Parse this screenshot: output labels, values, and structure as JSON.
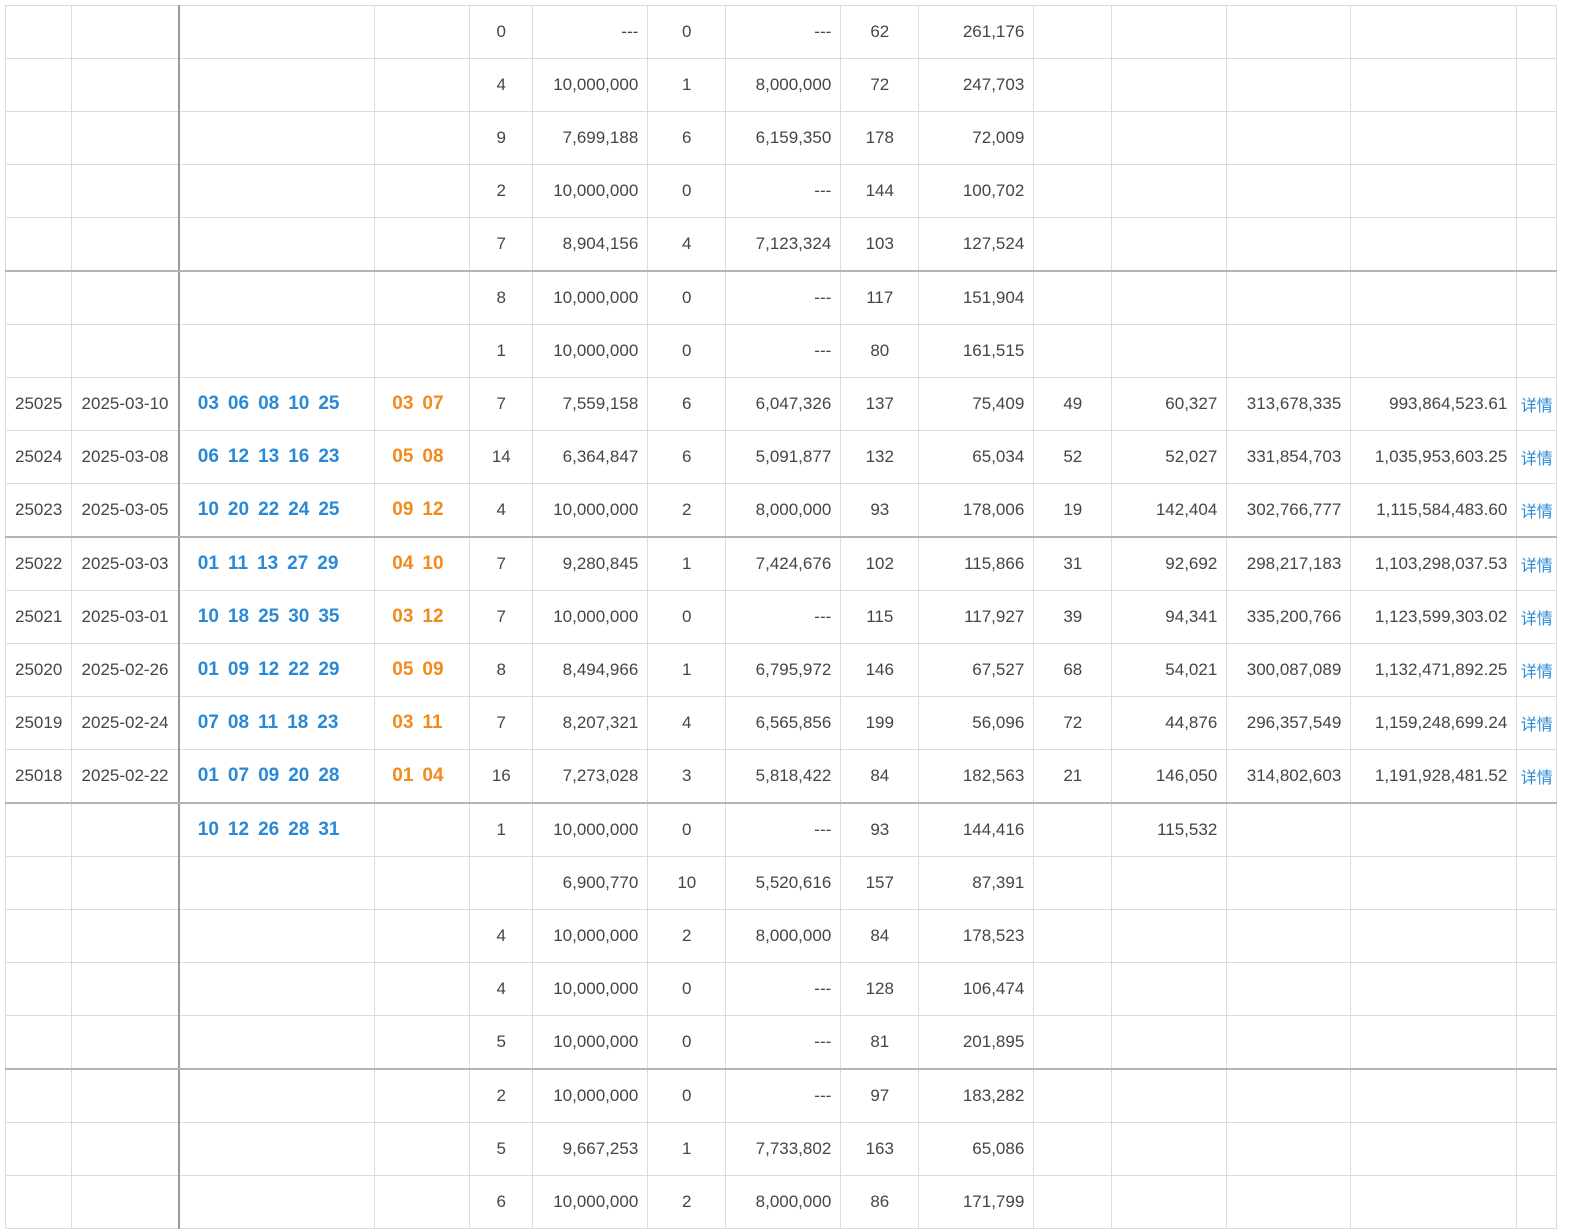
{
  "detail_label": "详情",
  "rows": [
    {
      "issue": "",
      "date": "",
      "front": [],
      "back": [],
      "n1": "0",
      "p1": "---",
      "n2": "0",
      "p2": "---",
      "n3": "62",
      "p3": "261,176",
      "n4": "",
      "p4": "",
      "sales": "",
      "pool": "",
      "blurred": true
    },
    {
      "issue": "",
      "date": "",
      "front": [],
      "back": [],
      "n1": "4",
      "p1": "10,000,000",
      "n2": "1",
      "p2": "8,000,000",
      "n3": "72",
      "p3": "247,703",
      "n4": "",
      "p4": "",
      "sales": "",
      "pool": "",
      "blurred": true
    },
    {
      "issue": "",
      "date": "",
      "front": [],
      "back": [],
      "n1": "9",
      "p1": "7,699,188",
      "n2": "6",
      "p2": "6,159,350",
      "n3": "178",
      "p3": "72,009",
      "n4": "",
      "p4": "",
      "sales": "",
      "pool": "",
      "blurred": true
    },
    {
      "issue": "",
      "date": "",
      "front": [],
      "back": [],
      "n1": "2",
      "p1": "10,000,000",
      "n2": "0",
      "p2": "---",
      "n3": "144",
      "p3": "100,702",
      "n4": "",
      "p4": "",
      "sales": "",
      "pool": "",
      "blurred": true
    },
    {
      "issue": "",
      "date": "",
      "front": [],
      "back": [],
      "n1": "7",
      "p1": "8,904,156",
      "n2": "4",
      "p2": "7,123,324",
      "n3": "103",
      "p3": "127,524",
      "n4": "",
      "p4": "",
      "sales": "",
      "pool": "",
      "blurred": true,
      "group_end": true
    },
    {
      "issue": "",
      "date": "",
      "front": [],
      "back": [],
      "n1": "8",
      "p1": "10,000,000",
      "n2": "0",
      "p2": "---",
      "n3": "117",
      "p3": "151,904",
      "n4": "",
      "p4": "",
      "sales": "",
      "pool": "",
      "blurred": true
    },
    {
      "issue": "",
      "date": "",
      "front": [],
      "back": [],
      "n1": "1",
      "p1": "10,000,000",
      "n2": "0",
      "p2": "---",
      "n3": "80",
      "p3": "161,515",
      "n4": "",
      "p4": "",
      "sales": "",
      "pool": "",
      "blurred": true
    },
    {
      "issue": "25025",
      "date": "2025-03-10",
      "front": [
        "03",
        "06",
        "08",
        "10",
        "25"
      ],
      "back": [
        "03",
        "07"
      ],
      "n1": "7",
      "p1": "7,559,158",
      "n2": "6",
      "p2": "6,047,326",
      "n3": "137",
      "p3": "75,409",
      "n4": "49",
      "p4": "60,327",
      "sales": "313,678,335",
      "pool": "993,864,523.61",
      "blurred": false
    },
    {
      "issue": "25024",
      "date": "2025-03-08",
      "front": [
        "06",
        "12",
        "13",
        "16",
        "23"
      ],
      "back": [
        "05",
        "08"
      ],
      "n1": "14",
      "p1": "6,364,847",
      "n2": "6",
      "p2": "5,091,877",
      "n3": "132",
      "p3": "65,034",
      "n4": "52",
      "p4": "52,027",
      "sales": "331,854,703",
      "pool": "1,035,953,603.25",
      "blurred": false
    },
    {
      "issue": "25023",
      "date": "2025-03-05",
      "front": [
        "10",
        "20",
        "22",
        "24",
        "25"
      ],
      "back": [
        "09",
        "12"
      ],
      "n1": "4",
      "p1": "10,000,000",
      "n2": "2",
      "p2": "8,000,000",
      "n3": "93",
      "p3": "178,006",
      "n4": "19",
      "p4": "142,404",
      "sales": "302,766,777",
      "pool": "1,115,584,483.60",
      "blurred": false,
      "group_end": true
    },
    {
      "issue": "25022",
      "date": "2025-03-03",
      "front": [
        "01",
        "11",
        "13",
        "27",
        "29"
      ],
      "back": [
        "04",
        "10"
      ],
      "n1": "7",
      "p1": "9,280,845",
      "n2": "1",
      "p2": "7,424,676",
      "n3": "102",
      "p3": "115,866",
      "n4": "31",
      "p4": "92,692",
      "sales": "298,217,183",
      "pool": "1,103,298,037.53",
      "blurred": false
    },
    {
      "issue": "25021",
      "date": "2025-03-01",
      "front": [
        "10",
        "18",
        "25",
        "30",
        "35"
      ],
      "back": [
        "03",
        "12"
      ],
      "n1": "7",
      "p1": "10,000,000",
      "n2": "0",
      "p2": "---",
      "n3": "115",
      "p3": "117,927",
      "n4": "39",
      "p4": "94,341",
      "sales": "335,200,766",
      "pool": "1,123,599,303.02",
      "blurred": false
    },
    {
      "issue": "25020",
      "date": "2025-02-26",
      "front": [
        "01",
        "09",
        "12",
        "22",
        "29"
      ],
      "back": [
        "05",
        "09"
      ],
      "n1": "8",
      "p1": "8,494,966",
      "n2": "1",
      "p2": "6,795,972",
      "n3": "146",
      "p3": "67,527",
      "n4": "68",
      "p4": "54,021",
      "sales": "300,087,089",
      "pool": "1,132,471,892.25",
      "blurred": false
    },
    {
      "issue": "25019",
      "date": "2025-02-24",
      "front": [
        "07",
        "08",
        "11",
        "18",
        "23"
      ],
      "back": [
        "03",
        "11"
      ],
      "n1": "7",
      "p1": "8,207,321",
      "n2": "4",
      "p2": "6,565,856",
      "n3": "199",
      "p3": "56,096",
      "n4": "72",
      "p4": "44,876",
      "sales": "296,357,549",
      "pool": "1,159,248,699.24",
      "blurred": false
    },
    {
      "issue": "25018",
      "date": "2025-02-22",
      "front": [
        "01",
        "07",
        "09",
        "20",
        "28"
      ],
      "back": [
        "01",
        "04"
      ],
      "n1": "16",
      "p1": "7,273,028",
      "n2": "3",
      "p2": "5,818,422",
      "n3": "84",
      "p3": "182,563",
      "n4": "21",
      "p4": "146,050",
      "sales": "314,802,603",
      "pool": "1,191,928,481.52",
      "blurred": false,
      "group_end": true
    },
    {
      "issue": "",
      "date": "",
      "front": [
        "10",
        "12",
        "26",
        "28",
        "31"
      ],
      "back": [],
      "n1": "1",
      "p1": "10,000,000",
      "n2": "0",
      "p2": "---",
      "n3": "93",
      "p3": "144,416",
      "n4": "",
      "p4": "115,532",
      "sales": "",
      "pool": "",
      "blurred": true
    },
    {
      "issue": "",
      "date": "",
      "front": [],
      "back": [],
      "n1": "",
      "p1": "6,900,770",
      "n2": "10",
      "p2": "5,520,616",
      "n3": "157",
      "p3": "87,391",
      "n4": "",
      "p4": "",
      "sales": "",
      "pool": "",
      "blurred": true
    },
    {
      "issue": "",
      "date": "",
      "front": [],
      "back": [],
      "n1": "4",
      "p1": "10,000,000",
      "n2": "2",
      "p2": "8,000,000",
      "n3": "84",
      "p3": "178,523",
      "n4": "",
      "p4": "",
      "sales": "",
      "pool": "",
      "blurred": true
    },
    {
      "issue": "",
      "date": "",
      "front": [],
      "back": [],
      "n1": "4",
      "p1": "10,000,000",
      "n2": "0",
      "p2": "---",
      "n3": "128",
      "p3": "106,474",
      "n4": "",
      "p4": "",
      "sales": "",
      "pool": "",
      "blurred": true
    },
    {
      "issue": "",
      "date": "",
      "front": [],
      "back": [],
      "n1": "5",
      "p1": "10,000,000",
      "n2": "0",
      "p2": "---",
      "n3": "81",
      "p3": "201,895",
      "n4": "",
      "p4": "",
      "sales": "",
      "pool": "",
      "blurred": true,
      "group_end": true
    },
    {
      "issue": "",
      "date": "",
      "front": [],
      "back": [],
      "n1": "2",
      "p1": "10,000,000",
      "n2": "0",
      "p2": "---",
      "n3": "97",
      "p3": "183,282",
      "n4": "",
      "p4": "",
      "sales": "",
      "pool": "",
      "blurred": true
    },
    {
      "issue": "",
      "date": "",
      "front": [],
      "back": [],
      "n1": "5",
      "p1": "9,667,253",
      "n2": "1",
      "p2": "7,733,802",
      "n3": "163",
      "p3": "65,086",
      "n4": "",
      "p4": "",
      "sales": "",
      "pool": "",
      "blurred": true
    },
    {
      "issue": "",
      "date": "",
      "front": [],
      "back": [],
      "n1": "6",
      "p1": "10,000,000",
      "n2": "2",
      "p2": "8,000,000",
      "n3": "86",
      "p3": "171,799",
      "n4": "",
      "p4": "",
      "sales": "",
      "pool": "",
      "blurred": true
    }
  ]
}
